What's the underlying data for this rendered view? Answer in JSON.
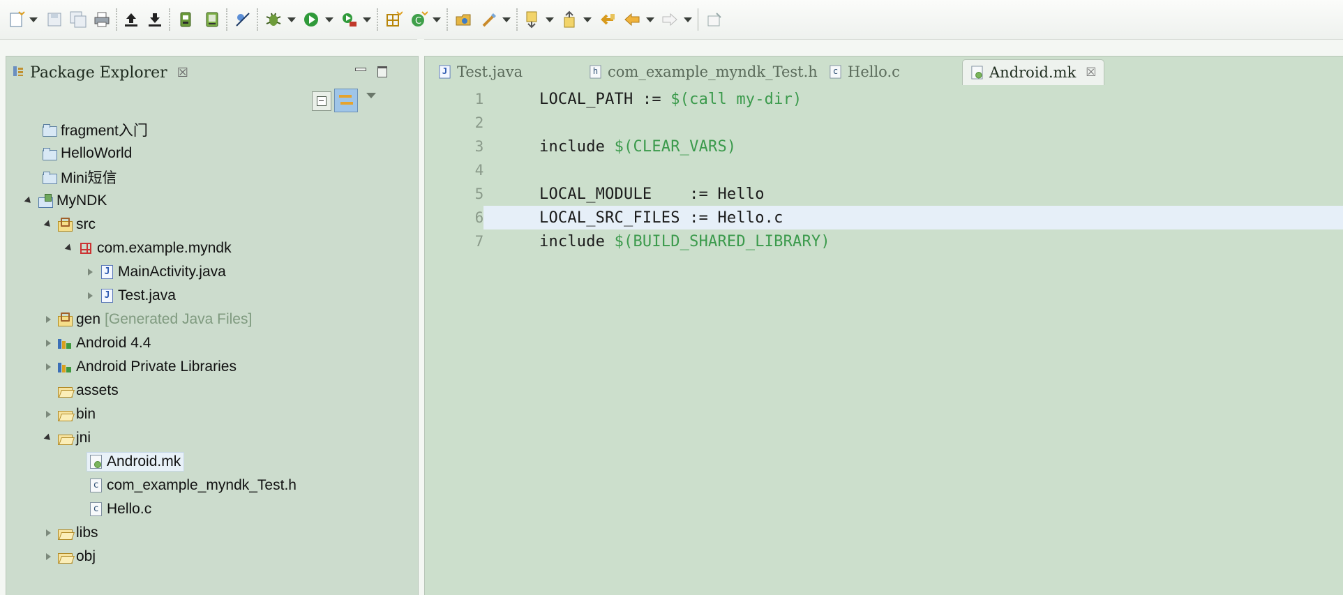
{
  "toolbar": {
    "buttons": [
      "new-wizard-icon",
      "save-icon",
      "save-all-icon",
      "print-icon",
      "upload-icon",
      "download-icon",
      "android-sdk-manager-icon",
      "android-avd-manager-icon",
      "skip-breakpoints-icon",
      "debug-icon",
      "run-icon",
      "external-tools-icon",
      "new-java-package-icon",
      "new-java-class-icon",
      "open-type-icon",
      "open-task-icon",
      "next-annotation-icon",
      "previous-annotation-icon",
      "last-edit-location-icon",
      "back-icon",
      "forward-icon",
      "pin-editor-icon"
    ]
  },
  "package_explorer": {
    "title": "Package Explorer",
    "close_glyph": "☒",
    "tree": [
      {
        "label": "fragment入门",
        "icon": "folder-icon",
        "twisty": "none"
      },
      {
        "label": "HelloWorld",
        "icon": "folder-icon",
        "twisty": "none"
      },
      {
        "label": "Mini短信",
        "icon": "folder-icon",
        "twisty": "none"
      },
      {
        "label": "MyNDK",
        "icon": "project-icon",
        "twisty": "expanded"
      },
      {
        "label": "src",
        "icon": "source-folder-icon",
        "twisty": "expanded"
      },
      {
        "label": "com.example.myndk",
        "icon": "package-icon",
        "twisty": "expanded"
      },
      {
        "label": "MainActivity.java",
        "icon": "java-file-icon",
        "twisty": "collapsed"
      },
      {
        "label": "Test.java",
        "icon": "java-file-icon",
        "twisty": "collapsed"
      },
      {
        "label": "gen",
        "note": "[Generated Java Files]",
        "icon": "source-folder-icon",
        "twisty": "collapsed"
      },
      {
        "label": "Android 4.4",
        "icon": "library-icon",
        "twisty": "collapsed"
      },
      {
        "label": "Android Private Libraries",
        "icon": "library-icon",
        "twisty": "collapsed"
      },
      {
        "label": "assets",
        "icon": "open-folder-icon",
        "twisty": "none"
      },
      {
        "label": "bin",
        "icon": "open-folder-icon",
        "twisty": "collapsed"
      },
      {
        "label": "jni",
        "icon": "open-folder-icon",
        "twisty": "expanded"
      },
      {
        "label": "Android.mk",
        "icon": "makefile-icon",
        "twisty": "none",
        "selected": true
      },
      {
        "label": "com_example_myndk_Test.h",
        "icon": "c-file-icon",
        "twisty": "none"
      },
      {
        "label": "Hello.c",
        "icon": "c-file-icon",
        "twisty": "none"
      },
      {
        "label": "libs",
        "icon": "open-folder-icon",
        "twisty": "collapsed"
      },
      {
        "label": "obj",
        "icon": "open-folder-icon",
        "twisty": "collapsed"
      }
    ]
  },
  "editor": {
    "tabs": [
      {
        "label": "Test.java",
        "icon": "java-file-icon",
        "active": false
      },
      {
        "label": "com_example_myndk_Test.h",
        "icon": "header-file-icon",
        "active": false
      },
      {
        "label": "Hello.c",
        "icon": "c-file-icon",
        "active": false
      },
      {
        "label": "Android.mk",
        "icon": "makefile-icon",
        "active": true,
        "close_glyph": "☒"
      }
    ],
    "current_line": 6,
    "lines": [
      {
        "num": "1",
        "plain": "LOCAL_PATH := ",
        "macro": "$(call my-dir)"
      },
      {
        "num": "2",
        "plain": "",
        "macro": ""
      },
      {
        "num": "3",
        "plain": "include ",
        "macro": "$(CLEAR_VARS)"
      },
      {
        "num": "4",
        "plain": "",
        "macro": ""
      },
      {
        "num": "5",
        "plain": "LOCAL_MODULE    := Hello",
        "macro": ""
      },
      {
        "num": "6",
        "plain": "LOCAL_SRC_FILES := Hello.c",
        "macro": ""
      },
      {
        "num": "7",
        "plain": "include ",
        "macro": "$(BUILD_SHARED_LIBRARY)"
      }
    ]
  },
  "colors": {
    "editor_bg": "#ccdfcc",
    "macro": "#3b9a4c",
    "current_line": "#e6eff8"
  }
}
